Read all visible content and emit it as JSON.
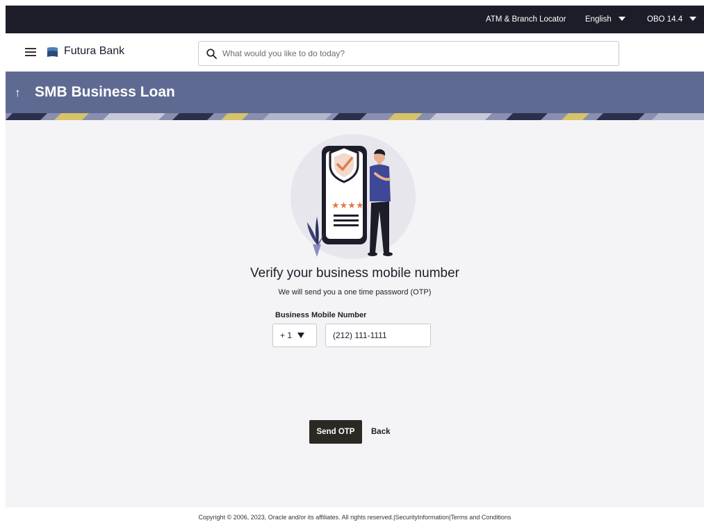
{
  "topbar": {
    "locator": "ATM & Branch Locator",
    "language": "English",
    "user": "OBO 14.4"
  },
  "header": {
    "brand": "Futura Bank",
    "search_placeholder": "What would you like to do today?"
  },
  "banner": {
    "back_glyph": "↑",
    "title": "SMB Business Loan"
  },
  "verify": {
    "heading": "Verify your business mobile number",
    "subheading": "We will send you a one time password (OTP)",
    "field_label": "Business Mobile Number",
    "country_code": "+ 1",
    "phone_value": "(212) 111-1111"
  },
  "actions": {
    "send_label": "Send OTP",
    "back_label": "Back"
  },
  "footer": {
    "copyright": "Copyright © 2006, 2023, Oracle and/or its affiliates. All rights reserved.",
    "sep1": "|",
    "security": "SecurityInformation",
    "sep2": "|",
    "terms": "Terms and Conditions"
  },
  "icons": {
    "menu": "hamburger-menu-icon",
    "logo": "futura-bank-logo",
    "search": "search-icon",
    "dropdown": "caret-down-icon"
  },
  "colors": {
    "topbar": "#1d1d2a",
    "banner": "#5f6a93",
    "accent": "#e07a4a",
    "primary_button": "#2c2925"
  }
}
